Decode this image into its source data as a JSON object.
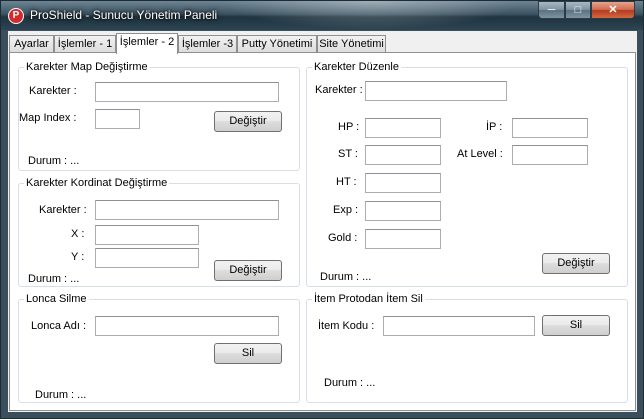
{
  "window": {
    "title": "ProShield - Sunucu Yönetim Paneli"
  },
  "caption": {
    "minimize": "─",
    "maximize": "□",
    "close": "✕"
  },
  "tabs": [
    "Ayarlar",
    "İşlemler - 1",
    "İşlemler - 2",
    "İşlemler -3",
    "Putty Yönetimi",
    "Site Yönetimi"
  ],
  "active_tab": "İşlemler - 2",
  "map_change": {
    "title": "Karekter Map Değiştirme",
    "char_label": "Karekter :",
    "char_value": "",
    "map_label": "Map Index :",
    "map_value": "",
    "button": "Değiştir",
    "status": "Durum : ..."
  },
  "coord_change": {
    "title": "Karekter Kordinat Değiştirme",
    "char_label": "Karekter :",
    "char_value": "",
    "x_label": "X :",
    "x_value": "",
    "y_label": "Y :",
    "y_value": "",
    "button": "Değiştir",
    "status": "Durum : ..."
  },
  "clan_delete": {
    "title": "Lonca Silme",
    "name_label": "Lonca Adı :",
    "name_value": "",
    "button": "Sil",
    "status": "Durum : ..."
  },
  "char_edit": {
    "title": "Karekter Düzenle",
    "char_label": "Karekter :",
    "char_value": "",
    "hp_label": "HP :",
    "st_label": "ST :",
    "ht_label": "HT :",
    "exp_label": "Exp :",
    "gold_label": "Gold :",
    "ip_label": "İP :",
    "at_level_label": "At Level :",
    "button": "Değiştir",
    "status": "Durum : ..."
  },
  "item_delete": {
    "title": "İtem Protodan İtem Sil",
    "code_label": "İtem Kodu :",
    "code_value": "",
    "button": "Sil",
    "status": "Durum : ..."
  },
  "colors": {
    "titlebar": "#2d4452",
    "close_button": "#c7502f",
    "group_border": "#d5dfe5"
  }
}
